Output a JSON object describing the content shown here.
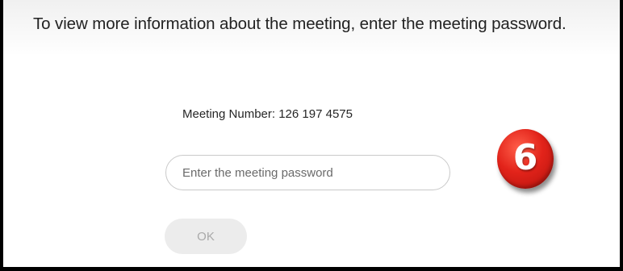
{
  "dialog": {
    "instruction": "To view more information about the meeting, enter the meeting password.",
    "meeting_number": "Meeting Number: 126 197 4575",
    "password_input": {
      "placeholder": "Enter the meeting password",
      "value": ""
    },
    "ok_label": "OK"
  },
  "annotation": {
    "step_number": "6",
    "badge_color": "#e2231a"
  }
}
